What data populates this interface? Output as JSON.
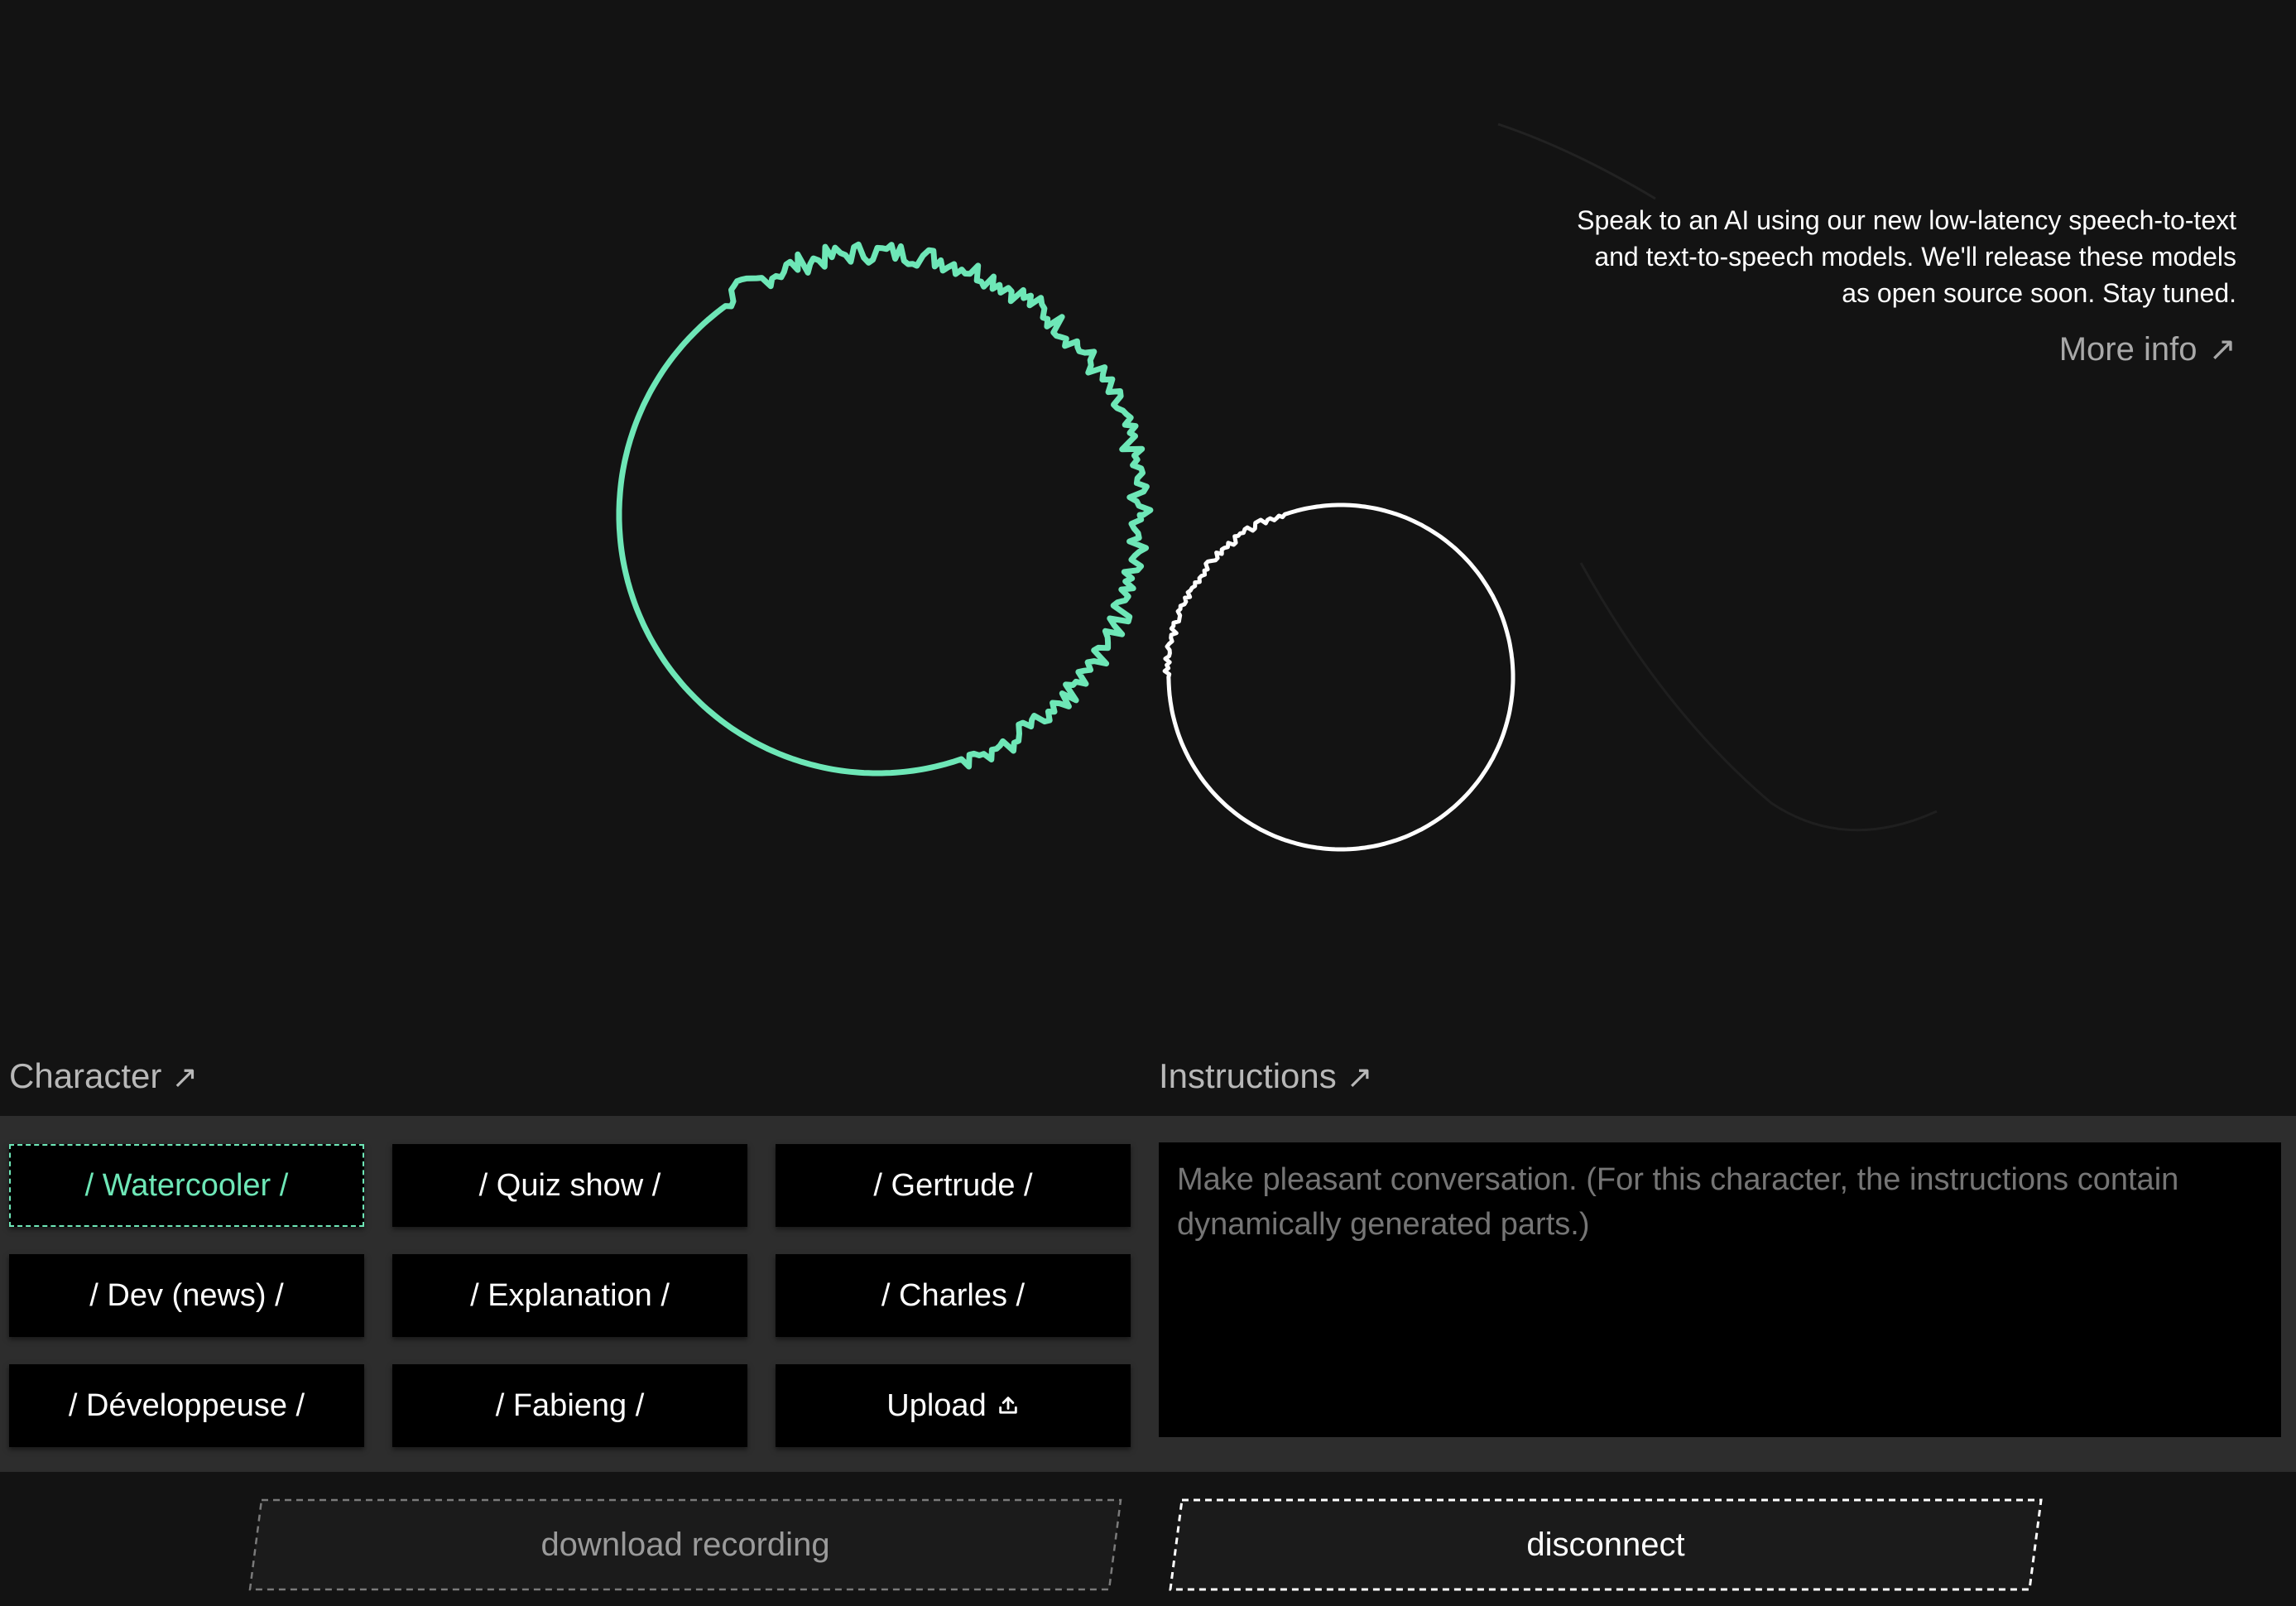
{
  "colors": {
    "background": "#131313",
    "accent": "#6ee7b7",
    "panel": "#2d2d2d"
  },
  "info": {
    "description_line1": "Speak to an AI using our new low-latency speech-to-text",
    "description_line2": "and text-to-speech models. We'll release these models",
    "description_line3": "as open source soon. Stay tuned.",
    "more_info_label": "More info"
  },
  "character": {
    "label": "Character",
    "selected": "/ Watercooler /",
    "options": [
      "/ Watercooler /",
      "/ Quiz show /",
      "/ Gertrude /",
      "/ Dev (news) /",
      "/ Explanation /",
      "/ Charles /",
      "/ Développeuse /",
      "/ Fabieng /",
      "Upload"
    ]
  },
  "instructions": {
    "label": "Instructions",
    "placeholder": "Make pleasant conversation. (For this character, the instructions contain dynamically generated parts.)"
  },
  "actions": {
    "download_label": "download recording",
    "disconnect_label": "disconnect"
  },
  "icons": {
    "external_link": "arrow-up-right-icon",
    "upload": "upload-icon"
  }
}
